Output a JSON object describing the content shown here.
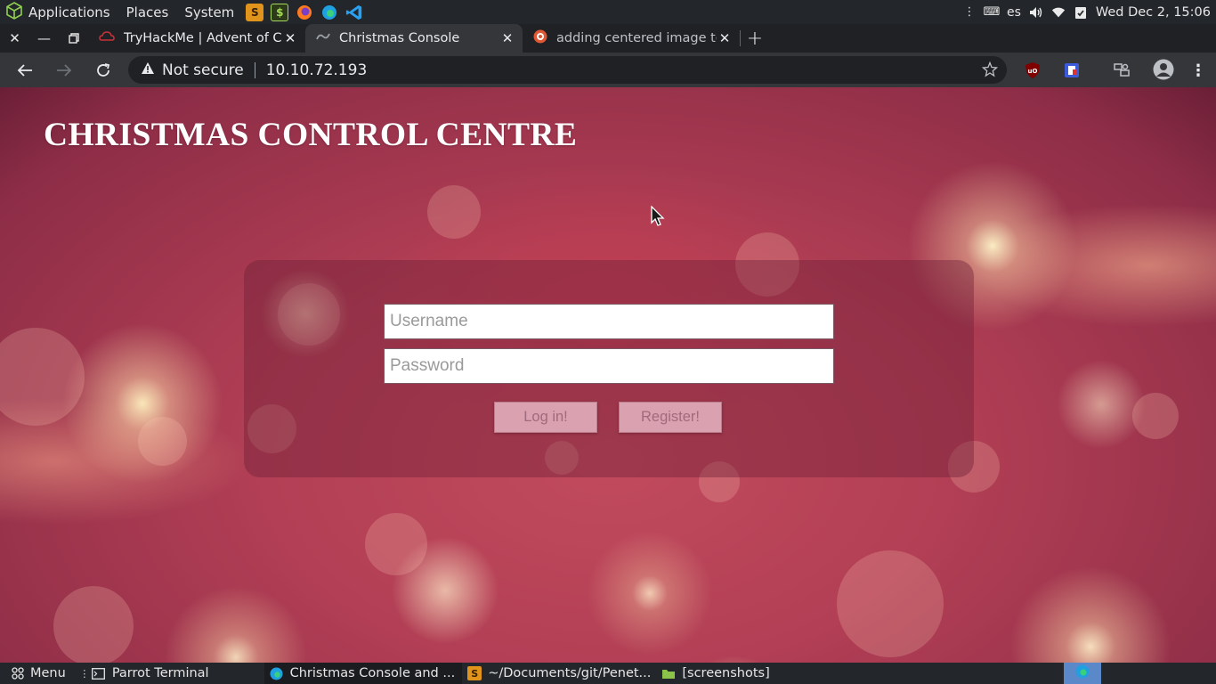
{
  "system_panel": {
    "menus": [
      "Applications",
      "Places",
      "System"
    ],
    "keyboard_layout": "es",
    "clock": "Wed Dec  2, 15:06"
  },
  "tabs": [
    {
      "title": "TryHackMe | Advent of Cy",
      "active": false,
      "icon": "tryhackme-icon"
    },
    {
      "title": "Christmas Console",
      "active": true,
      "icon": "page-icon"
    },
    {
      "title": "adding centered image to",
      "active": false,
      "icon": "duckduckgo-icon"
    }
  ],
  "toolbar": {
    "security_label": "Not secure",
    "url": "10.10.72.193"
  },
  "page": {
    "title": "CHRISTMAS CONTROL CENTRE",
    "username_placeholder": "Username",
    "password_placeholder": "Password",
    "login_label": "Log in!",
    "register_label": "Register!"
  },
  "taskbar": {
    "menu_label": "Menu",
    "items": [
      {
        "label": "Parrot Terminal",
        "active": false
      },
      {
        "label": "Christmas Console and ...",
        "active": true
      },
      {
        "label": "~/Documents/git/Penet...",
        "active": false
      },
      {
        "label": "[screenshots]",
        "active": false
      }
    ]
  },
  "colors": {
    "panel": "#23262b",
    "tab_strip": "#202124",
    "toolbar": "#35363a",
    "accent_blue": "#5b88c9"
  }
}
